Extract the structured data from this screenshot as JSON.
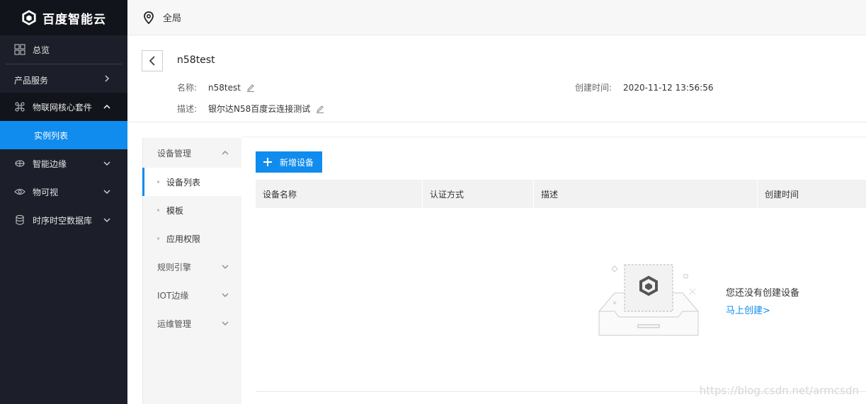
{
  "brand": {
    "name": "百度智能云"
  },
  "sidebar": {
    "items": [
      {
        "label": "总览",
        "icon": "grid-icon"
      },
      {
        "label": "产品服务",
        "icon": "chevron-right-icon"
      },
      {
        "label": "物联网核心套件",
        "icon": "iot-core-icon"
      },
      {
        "label": "实例列表"
      },
      {
        "label": "智能边缘",
        "icon": "edge-icon"
      },
      {
        "label": "物可视",
        "icon": "eye-icon"
      },
      {
        "label": "时序时空数据库",
        "icon": "database-icon"
      }
    ]
  },
  "topbar": {
    "region": "全局"
  },
  "instance": {
    "title": "n58test",
    "name_label": "名称:",
    "name_value": "n58test",
    "desc_label": "描述:",
    "desc_value": "银尔达N58百度云连接测试",
    "created_label": "创建时间:",
    "created_value": "2020-11-12 13:56:56"
  },
  "subnav": {
    "device_mgmt": "设备管理",
    "device_list": "设备列表",
    "template": "模板",
    "app_permission": "应用权限",
    "rule_engine": "规则引擎",
    "iot_edge": "IOT边缘",
    "ops_mgmt": "运维管理"
  },
  "toolbar": {
    "add_device": "新增设备"
  },
  "table": {
    "columns": [
      "设备名称",
      "认证方式",
      "描述",
      "创建时间"
    ]
  },
  "empty_state": {
    "message": "您还没有创建设备",
    "link": "马上创建>"
  },
  "watermark": "https://blog.csdn.net/armcsdn",
  "colors": {
    "accent": "#108cee",
    "sidebar_bg": "#1c1f2a"
  }
}
